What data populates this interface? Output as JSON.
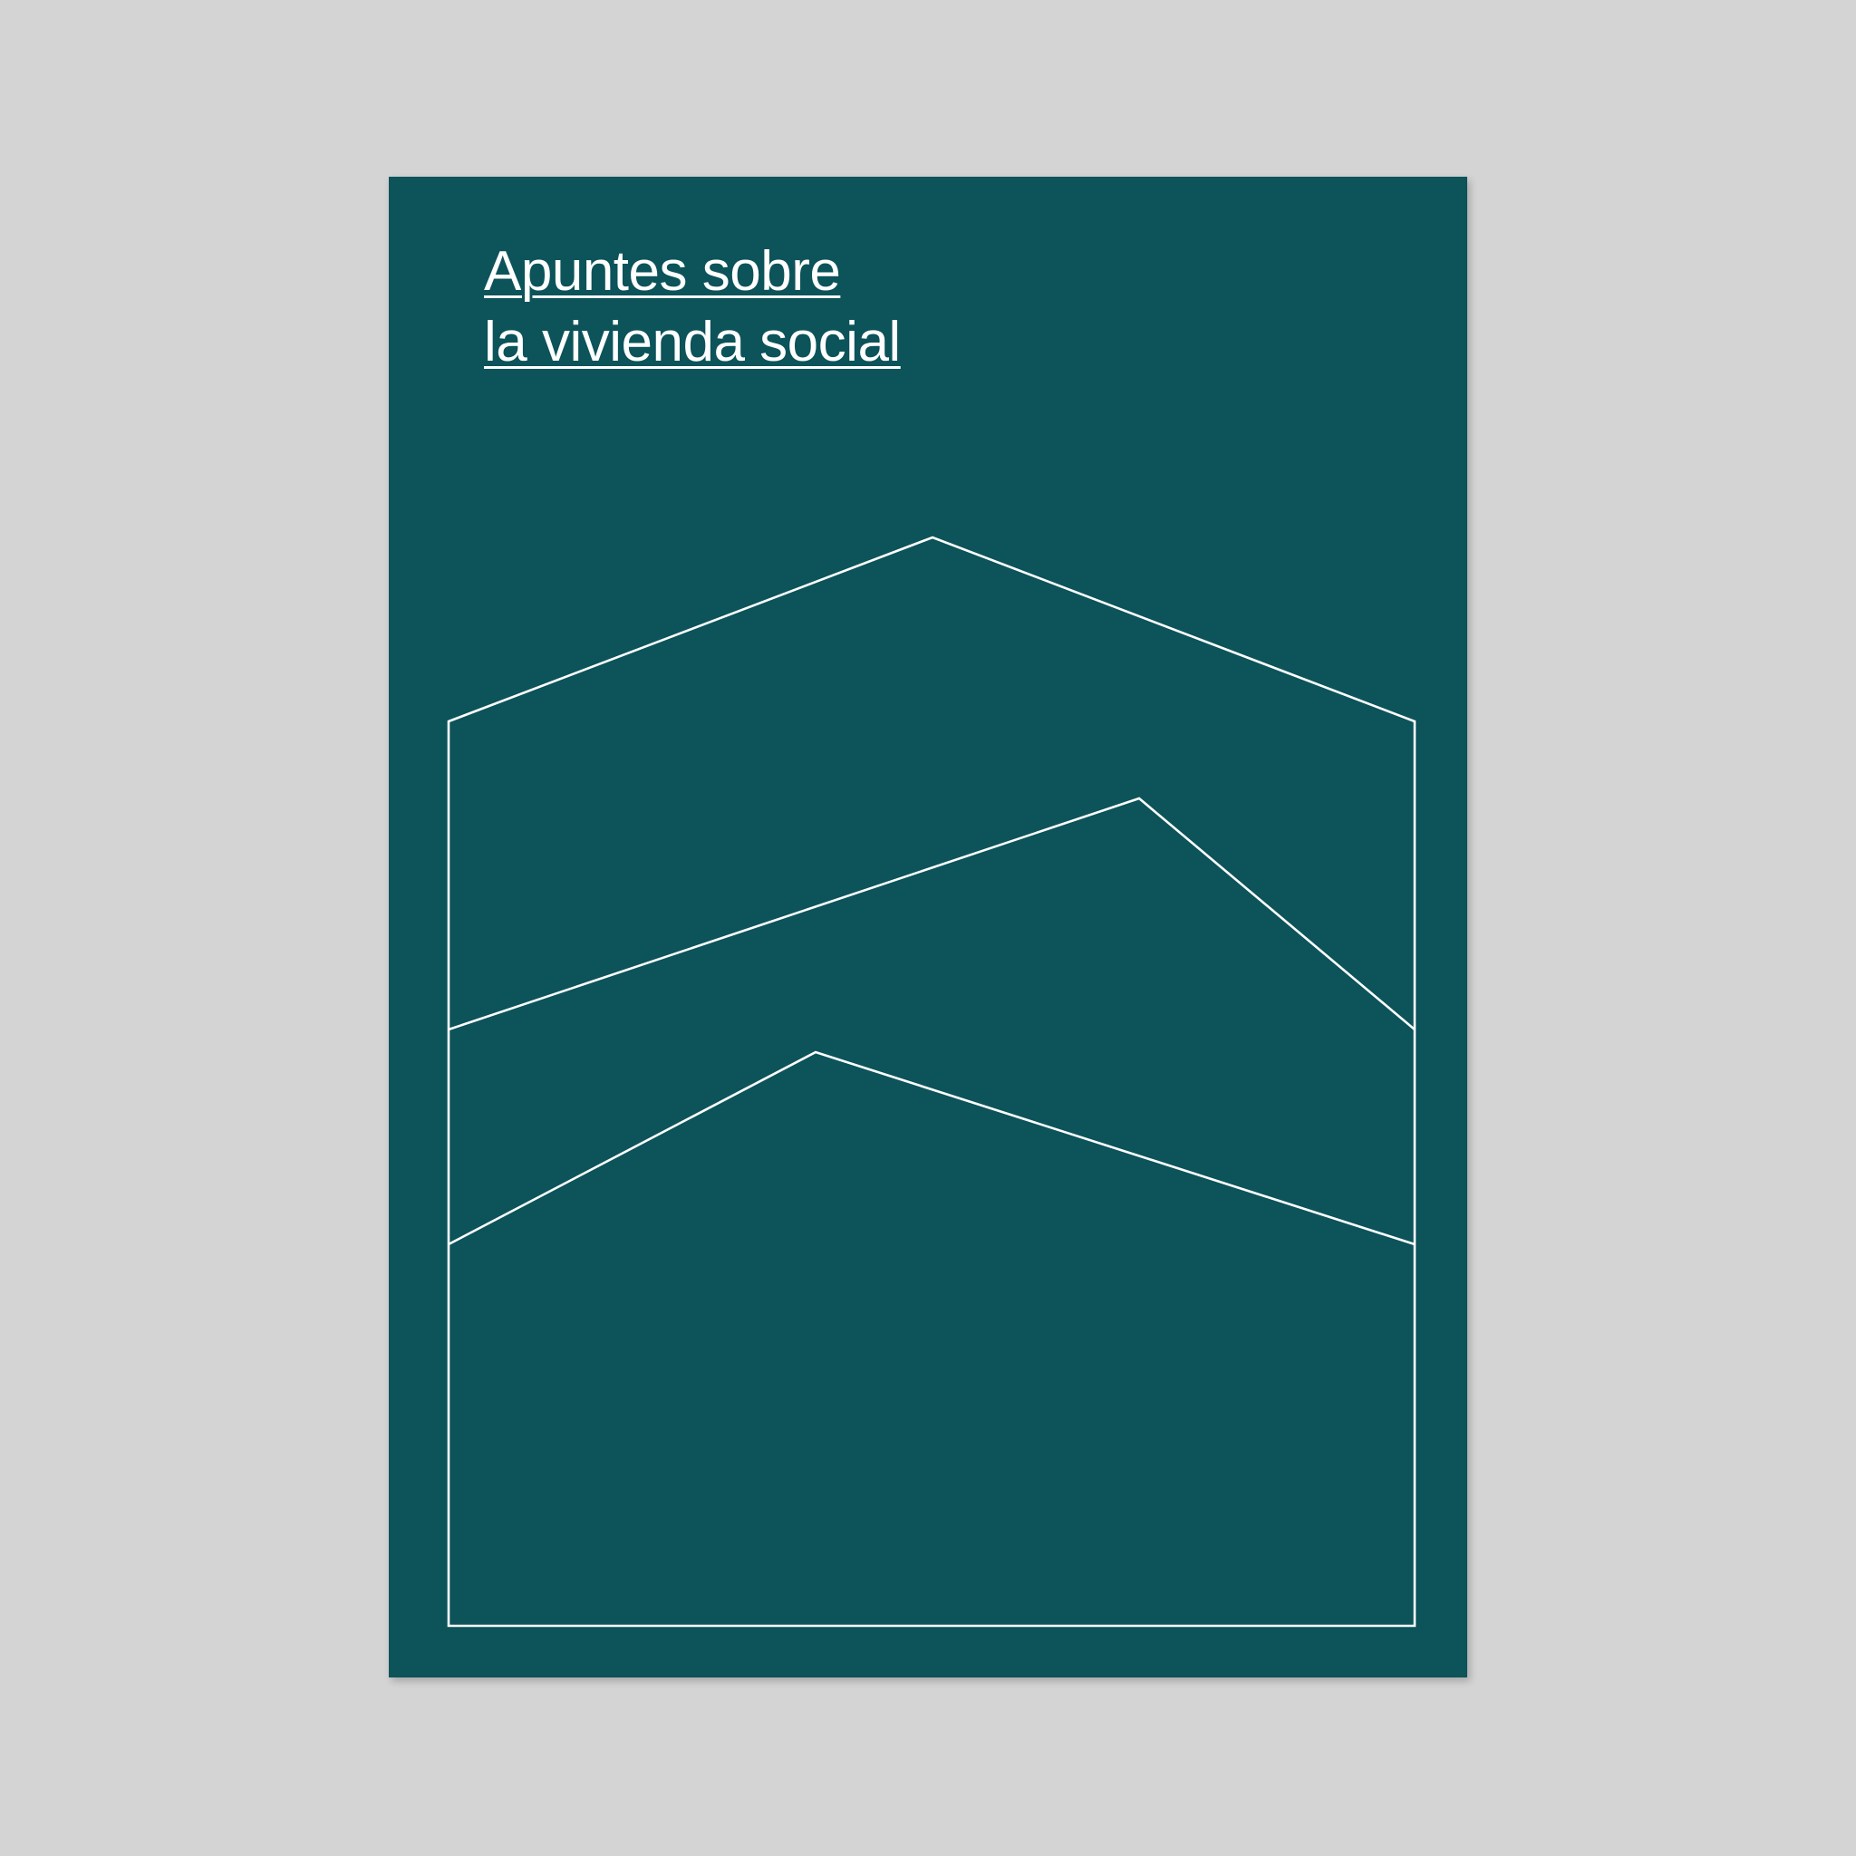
{
  "cover": {
    "background_color": "#0c535a",
    "page_background_color": "#d4d4d4",
    "line_color": "#ffffff",
    "title_lines": [
      "Apuntes sobre",
      "la vivienda social"
    ]
  }
}
